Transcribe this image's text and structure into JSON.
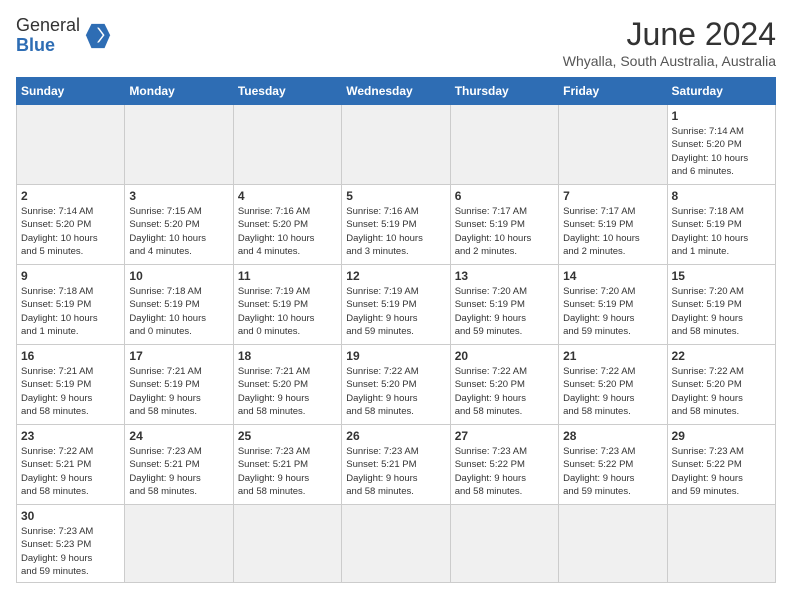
{
  "header": {
    "logo_general": "General",
    "logo_blue": "Blue",
    "month_year": "June 2024",
    "location": "Whyalla, South Australia, Australia"
  },
  "days_of_week": [
    "Sunday",
    "Monday",
    "Tuesday",
    "Wednesday",
    "Thursday",
    "Friday",
    "Saturday"
  ],
  "weeks": [
    [
      {
        "day": "",
        "info": "",
        "empty": true
      },
      {
        "day": "",
        "info": "",
        "empty": true
      },
      {
        "day": "",
        "info": "",
        "empty": true
      },
      {
        "day": "",
        "info": "",
        "empty": true
      },
      {
        "day": "",
        "info": "",
        "empty": true
      },
      {
        "day": "",
        "info": "",
        "empty": true
      },
      {
        "day": "1",
        "info": "Sunrise: 7:14 AM\nSunset: 5:20 PM\nDaylight: 10 hours\nand 6 minutes."
      }
    ],
    [
      {
        "day": "2",
        "info": "Sunrise: 7:14 AM\nSunset: 5:20 PM\nDaylight: 10 hours\nand 5 minutes."
      },
      {
        "day": "3",
        "info": "Sunrise: 7:15 AM\nSunset: 5:20 PM\nDaylight: 10 hours\nand 4 minutes."
      },
      {
        "day": "4",
        "info": "Sunrise: 7:16 AM\nSunset: 5:20 PM\nDaylight: 10 hours\nand 4 minutes."
      },
      {
        "day": "5",
        "info": "Sunrise: 7:16 AM\nSunset: 5:19 PM\nDaylight: 10 hours\nand 3 minutes."
      },
      {
        "day": "6",
        "info": "Sunrise: 7:17 AM\nSunset: 5:19 PM\nDaylight: 10 hours\nand 2 minutes."
      },
      {
        "day": "7",
        "info": "Sunrise: 7:17 AM\nSunset: 5:19 PM\nDaylight: 10 hours\nand 2 minutes."
      },
      {
        "day": "8",
        "info": "Sunrise: 7:18 AM\nSunset: 5:19 PM\nDaylight: 10 hours\nand 1 minute."
      }
    ],
    [
      {
        "day": "9",
        "info": "Sunrise: 7:18 AM\nSunset: 5:19 PM\nDaylight: 10 hours\nand 1 minute."
      },
      {
        "day": "10",
        "info": "Sunrise: 7:18 AM\nSunset: 5:19 PM\nDaylight: 10 hours\nand 0 minutes."
      },
      {
        "day": "11",
        "info": "Sunrise: 7:19 AM\nSunset: 5:19 PM\nDaylight: 10 hours\nand 0 minutes."
      },
      {
        "day": "12",
        "info": "Sunrise: 7:19 AM\nSunset: 5:19 PM\nDaylight: 9 hours\nand 59 minutes."
      },
      {
        "day": "13",
        "info": "Sunrise: 7:20 AM\nSunset: 5:19 PM\nDaylight: 9 hours\nand 59 minutes."
      },
      {
        "day": "14",
        "info": "Sunrise: 7:20 AM\nSunset: 5:19 PM\nDaylight: 9 hours\nand 59 minutes."
      },
      {
        "day": "15",
        "info": "Sunrise: 7:20 AM\nSunset: 5:19 PM\nDaylight: 9 hours\nand 58 minutes."
      }
    ],
    [
      {
        "day": "16",
        "info": "Sunrise: 7:21 AM\nSunset: 5:19 PM\nDaylight: 9 hours\nand 58 minutes."
      },
      {
        "day": "17",
        "info": "Sunrise: 7:21 AM\nSunset: 5:19 PM\nDaylight: 9 hours\nand 58 minutes."
      },
      {
        "day": "18",
        "info": "Sunrise: 7:21 AM\nSunset: 5:20 PM\nDaylight: 9 hours\nand 58 minutes."
      },
      {
        "day": "19",
        "info": "Sunrise: 7:22 AM\nSunset: 5:20 PM\nDaylight: 9 hours\nand 58 minutes."
      },
      {
        "day": "20",
        "info": "Sunrise: 7:22 AM\nSunset: 5:20 PM\nDaylight: 9 hours\nand 58 minutes."
      },
      {
        "day": "21",
        "info": "Sunrise: 7:22 AM\nSunset: 5:20 PM\nDaylight: 9 hours\nand 58 minutes."
      },
      {
        "day": "22",
        "info": "Sunrise: 7:22 AM\nSunset: 5:20 PM\nDaylight: 9 hours\nand 58 minutes."
      }
    ],
    [
      {
        "day": "23",
        "info": "Sunrise: 7:22 AM\nSunset: 5:21 PM\nDaylight: 9 hours\nand 58 minutes."
      },
      {
        "day": "24",
        "info": "Sunrise: 7:23 AM\nSunset: 5:21 PM\nDaylight: 9 hours\nand 58 minutes."
      },
      {
        "day": "25",
        "info": "Sunrise: 7:23 AM\nSunset: 5:21 PM\nDaylight: 9 hours\nand 58 minutes."
      },
      {
        "day": "26",
        "info": "Sunrise: 7:23 AM\nSunset: 5:21 PM\nDaylight: 9 hours\nand 58 minutes."
      },
      {
        "day": "27",
        "info": "Sunrise: 7:23 AM\nSunset: 5:22 PM\nDaylight: 9 hours\nand 58 minutes."
      },
      {
        "day": "28",
        "info": "Sunrise: 7:23 AM\nSunset: 5:22 PM\nDaylight: 9 hours\nand 59 minutes."
      },
      {
        "day": "29",
        "info": "Sunrise: 7:23 AM\nSunset: 5:22 PM\nDaylight: 9 hours\nand 59 minutes."
      }
    ],
    [
      {
        "day": "30",
        "info": "Sunrise: 7:23 AM\nSunset: 5:23 PM\nDaylight: 9 hours\nand 59 minutes."
      },
      {
        "day": "",
        "info": "",
        "empty": true
      },
      {
        "day": "",
        "info": "",
        "empty": true
      },
      {
        "day": "",
        "info": "",
        "empty": true
      },
      {
        "day": "",
        "info": "",
        "empty": true
      },
      {
        "day": "",
        "info": "",
        "empty": true
      },
      {
        "day": "",
        "info": "",
        "empty": true
      }
    ]
  ]
}
